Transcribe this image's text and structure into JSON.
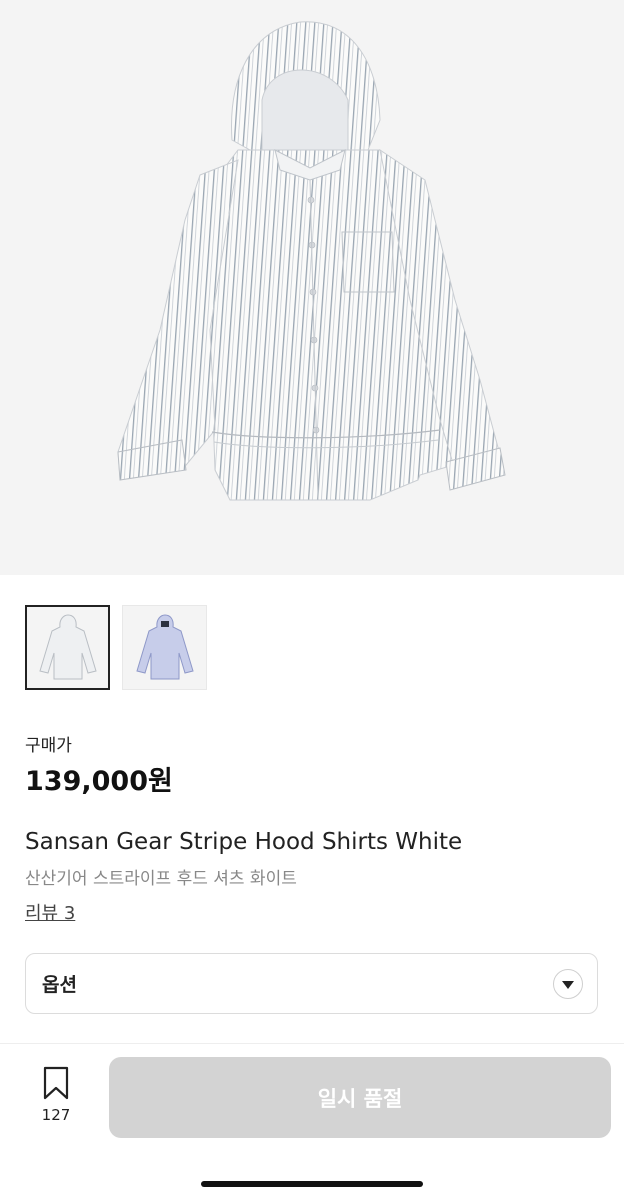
{
  "product": {
    "images": [
      "shirt-white",
      "shirt-blue"
    ],
    "colors": {
      "stripe_white": "#9aa6b2",
      "stripe_blue": "#7f8ec9"
    },
    "price_label": "구매가",
    "price": "139,000원",
    "name_en": "Sansan Gear Stripe Hood Shirts White",
    "name_ko": "산산기어 스트라이프 후드 셔츠 화이트",
    "reviews": "리뷰 3"
  },
  "option": {
    "label": "옵션"
  },
  "bottom_bar": {
    "bookmark_count": "127",
    "soldout_label": "일시 품절"
  }
}
